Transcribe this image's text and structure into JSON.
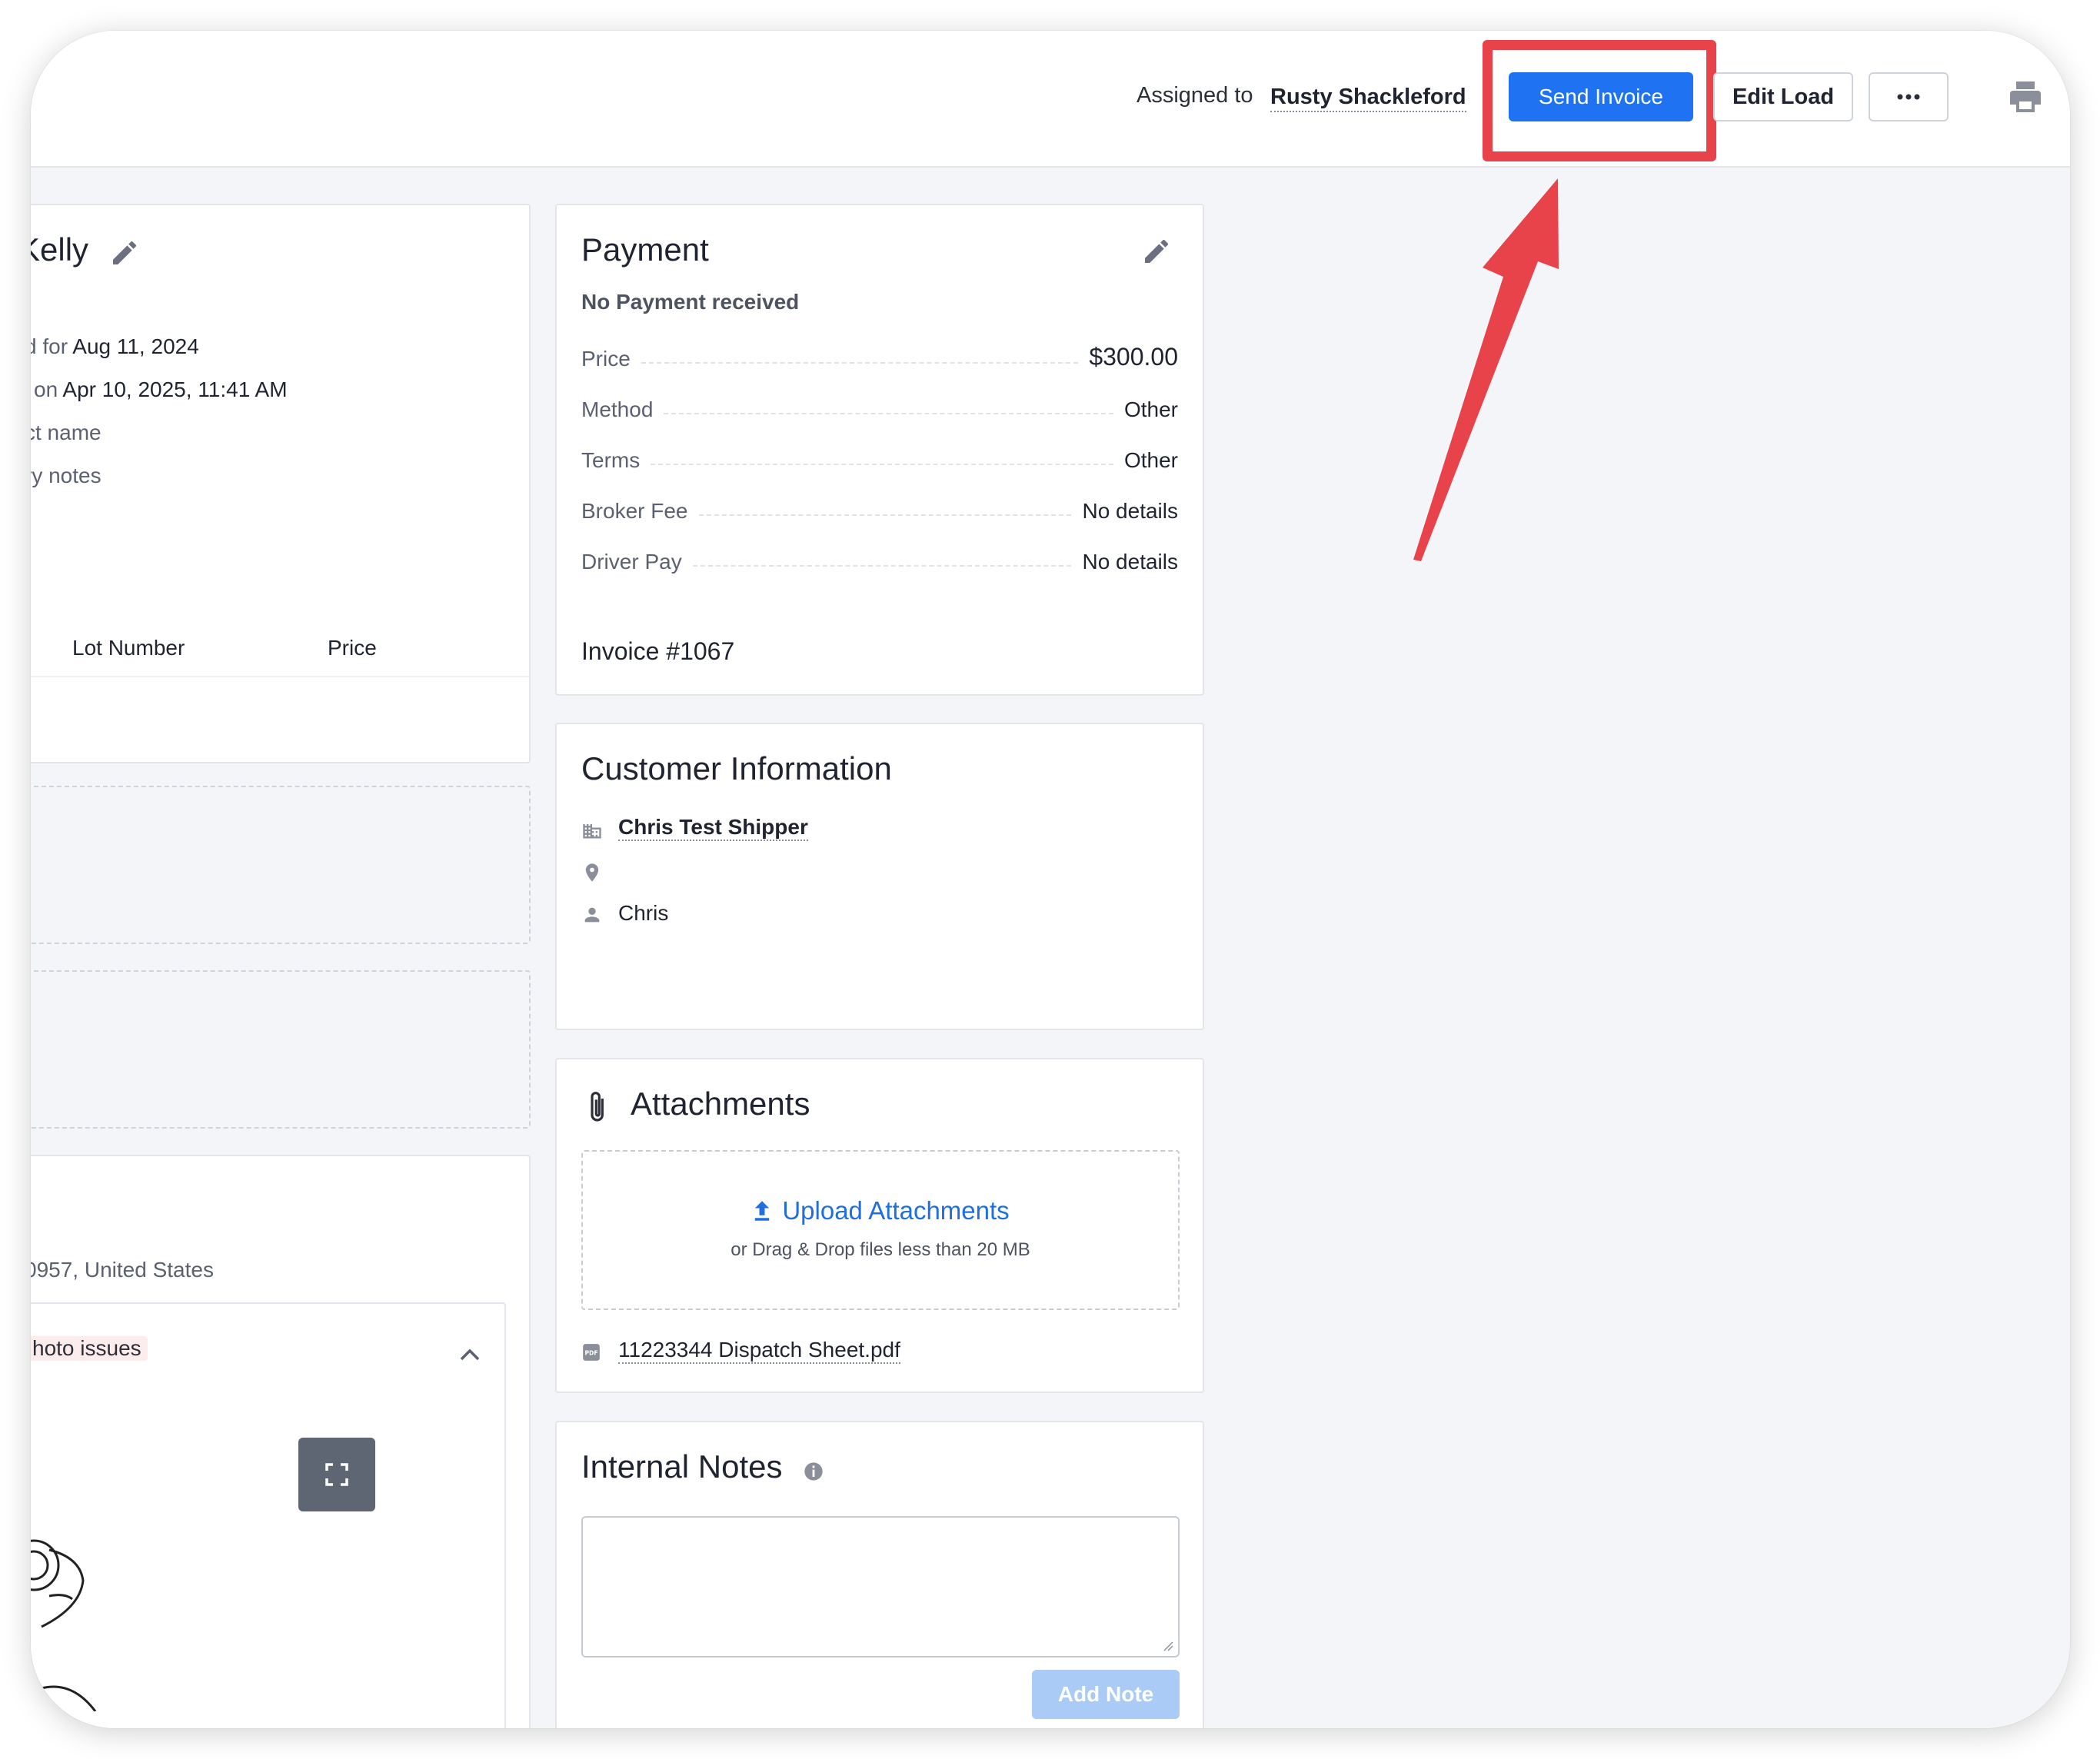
{
  "header": {
    "assigned_label": "Assigned to",
    "assigned_name": "Rusty Shackleford",
    "send_invoice_label": "Send Invoice",
    "edit_load_label": "Edit Load",
    "more_label": "•••"
  },
  "load_card": {
    "title_fragment": "Kelly",
    "line1_prefix": "d for",
    "line1_value": "Aug 11, 2024",
    "line2_prefix": "on",
    "line2_value": "Apr 10, 2025, 11:41 AM",
    "line3": "ct name",
    "line4": "ry notes",
    "columns": [
      "Lot Number",
      "Price"
    ]
  },
  "location_card": {
    "address": "0957, United States",
    "tag": "hoto issues"
  },
  "payment": {
    "title": "Payment",
    "status": "No Payment received",
    "rows": [
      {
        "label": "Price",
        "value": "$300.00"
      },
      {
        "label": "Method",
        "value": "Other"
      },
      {
        "label": "Terms",
        "value": "Other"
      },
      {
        "label": "Broker Fee",
        "value": "No details"
      },
      {
        "label": "Driver Pay",
        "value": "No details"
      }
    ],
    "invoice": "Invoice #1067"
  },
  "customer": {
    "title": "Customer Information",
    "company": "Chris Test Shipper",
    "contact": "Chris"
  },
  "attachments": {
    "title": "Attachments",
    "upload_label": "Upload Attachments",
    "upload_hint": "or Drag & Drop files less than 20 MB",
    "files": [
      "11223344 Dispatch Sheet.pdf"
    ]
  },
  "notes": {
    "title": "Internal Notes",
    "add_note_label": "Add Note"
  },
  "colors": {
    "primary": "#1f73f2",
    "highlight": "#e8434a",
    "disabled": "#a9cbf6"
  }
}
